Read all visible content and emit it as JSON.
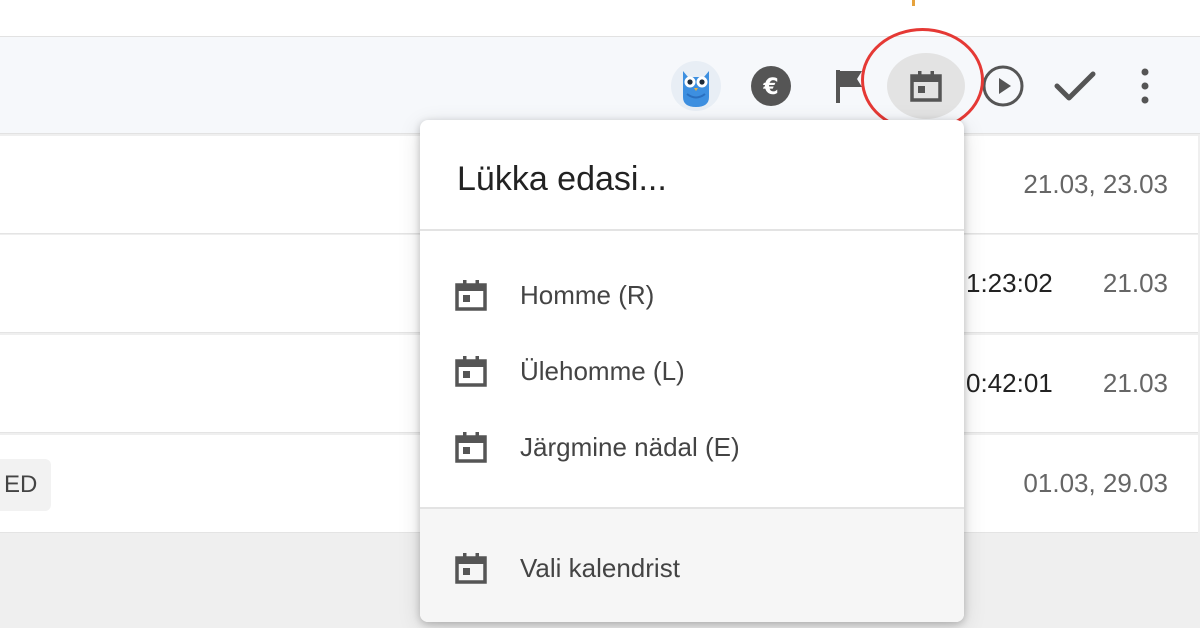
{
  "toolbar": {
    "icons": [
      "owl-avatar-icon",
      "euro-icon",
      "flag-icon",
      "calendar-icon",
      "play-icon",
      "check-icon",
      "more-vertical-icon"
    ],
    "highlight_color": "#e53935"
  },
  "rows": [
    {
      "dates": "21.03, 23.03"
    },
    {
      "duration": "1:23:02",
      "dates": "21.03"
    },
    {
      "duration": "0:42:01",
      "dates": "21.03"
    },
    {
      "tag": "ED",
      "dates": "01.03, 29.03"
    }
  ],
  "menu": {
    "title": "Lükka edasi...",
    "items": [
      {
        "label": "Homme (R)",
        "icon": "calendar-icon"
      },
      {
        "label": "Ülehomme (L)",
        "icon": "calendar-icon"
      },
      {
        "label": "Järgmine nädal (E)",
        "icon": "calendar-icon"
      }
    ],
    "footer_item": {
      "label": "Vali kalendrist",
      "icon": "calendar-icon"
    }
  },
  "colors": {
    "accent_orange": "#e6a23c",
    "owl_blue": "#3d8fe0",
    "icon_gray": "#555555"
  }
}
